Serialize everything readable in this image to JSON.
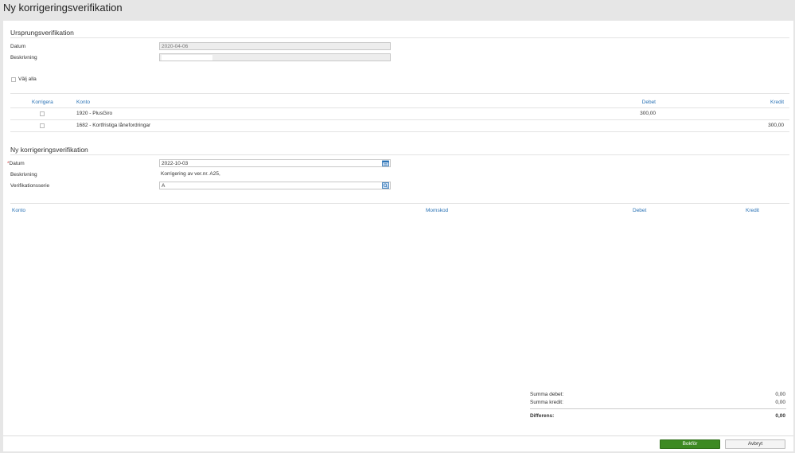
{
  "page": {
    "title": "Ny korrigeringsverifikation"
  },
  "original": {
    "heading": "Ursprungsverifikation",
    "date_label": "Datum",
    "date_value": "2020-04-06",
    "description_label": "Beskrivning",
    "select_all_label": "Välj alla",
    "columns": {
      "correct": "Korrigera",
      "account": "Konto",
      "debit": "Debet",
      "credit": "Kredit"
    },
    "rows": [
      {
        "account": "1920 - PlusGiro",
        "debit": "300,00",
        "credit": ""
      },
      {
        "account": "1682 - Kortfristiga lånefordringar",
        "debit": "",
        "credit": "300,00"
      }
    ]
  },
  "new_entry": {
    "heading": "Ny korrigeringsverifikation",
    "required_mark": "*",
    "date_label": "Datum",
    "date_value": "2022-10-03",
    "description_label": "Beskrivning",
    "description_value": "Korrigering av ver.nr. A25,",
    "series_label": "Verifikationsserie",
    "series_value": "A",
    "columns": {
      "account": "Konto",
      "vat_code": "Momskod",
      "debit": "Debet",
      "credit": "Kredit"
    }
  },
  "summary": {
    "debit_label": "Summa debet:",
    "debit_value": "0,00",
    "credit_label": "Summa kredit:",
    "credit_value": "0,00",
    "difference_label": "Differens:",
    "difference_value": "0,00"
  },
  "footer": {
    "post_button": "Bokför",
    "cancel_button": "Avbryt"
  },
  "colors": {
    "accent": "#2a72b5",
    "primary_button": "#3d8a22",
    "required": "#cc3333"
  },
  "icons": {
    "date_picker": "calendar-icon",
    "series_lookup": "search-icon"
  }
}
